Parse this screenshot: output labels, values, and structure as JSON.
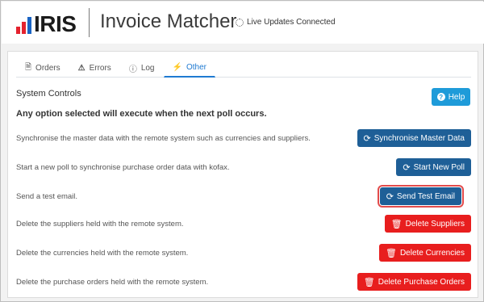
{
  "header": {
    "logo_text": "IRIS",
    "app_title": "Invoice Matcher",
    "status": "Live Updates Connected",
    "colors": {
      "logo_red": "#e4222e",
      "logo_blue": "#1a64c4"
    }
  },
  "tabs": [
    {
      "label": "Orders",
      "icon": "document-icon"
    },
    {
      "label": "Errors",
      "icon": "warning-icon"
    },
    {
      "label": "Log",
      "icon": "info-icon"
    },
    {
      "label": "Other",
      "icon": "bolt-icon",
      "active": true
    }
  ],
  "controls": {
    "title": "System Controls",
    "subtitle": "Any option selected will execute when the next poll occurs.",
    "help_label": "Help",
    "help_icon": "?"
  },
  "rows": [
    {
      "text": "Synchronise the master data with the remote system such as currencies and suppliers.",
      "button": "Synchronise Master Data",
      "color": "#1e5f97",
      "icon": "refresh-icon"
    },
    {
      "text": "Start a new poll to synchronise purchase order data with kofax.",
      "button": "Start New Poll",
      "color": "#1e5f97",
      "icon": "refresh-icon"
    },
    {
      "text": "Send a test email.",
      "button": "Send Test Email",
      "color": "#1e5f97",
      "icon": "refresh-icon",
      "highlighted": true
    },
    {
      "text": "Delete the suppliers held with the remote system.",
      "button": "Delete Suppliers",
      "color": "#e81e1e",
      "icon": "trash-icon"
    },
    {
      "text": "Delete the currencies held with the remote system.",
      "button": "Delete Currencies",
      "color": "#e81e1e",
      "icon": "trash-icon"
    },
    {
      "text": "Delete the purchase orders held with the remote system.",
      "button": "Delete Purchase Orders",
      "color": "#e81e1e",
      "icon": "trash-icon"
    }
  ]
}
